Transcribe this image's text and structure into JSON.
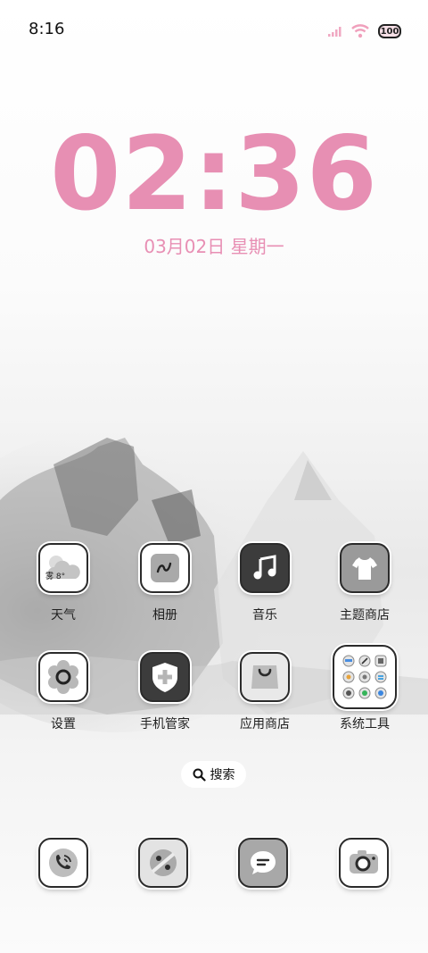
{
  "status_bar": {
    "time": "8:16",
    "battery": "100"
  },
  "lock_clock": {
    "time": "02:36",
    "date": "03月02日  星期一"
  },
  "apps": [
    {
      "label": "天气",
      "weather_text": "雾 8°"
    },
    {
      "label": "相册"
    },
    {
      "label": "音乐"
    },
    {
      "label": "主题商店"
    },
    {
      "label": "设置"
    },
    {
      "label": "手机管家"
    },
    {
      "label": "应用商店"
    },
    {
      "label": "系统工具"
    }
  ],
  "search": {
    "label": "搜索"
  },
  "dock": [
    "phone-icon",
    "browser-icon",
    "messages-icon",
    "camera-icon"
  ],
  "colors": {
    "clock_pink": "#e78fb3",
    "icon_dark": "#3c3c3c",
    "icon_gray": "#8e8e8e"
  }
}
